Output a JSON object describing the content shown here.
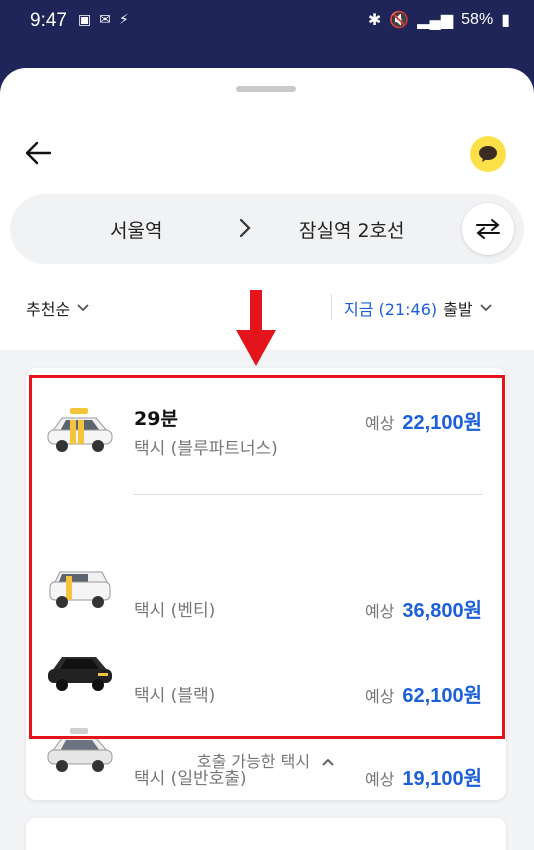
{
  "status_bar": {
    "time": "9:47",
    "battery": "58%"
  },
  "header": {
    "back_icon": "back-arrow-icon",
    "talk_icon": "chat-bubble-icon"
  },
  "route": {
    "origin": "서울역",
    "destination": "잠실역 2호선",
    "swap_icon": "swap-icon"
  },
  "filters": {
    "sort_label": "추천순",
    "time_prefix": "지금 (21:46)",
    "time_suffix": "출발"
  },
  "taxi_options": [
    {
      "duration": "29분",
      "name": "택시 (블루파트너스)",
      "price_label": "예상",
      "price": "22,100원",
      "car_color": "#f6c43c"
    },
    {
      "name": "택시 (벤티)",
      "price_label": "예상",
      "price": "36,800원",
      "car_color": "#f6c43c"
    },
    {
      "name": "택시 (블랙)",
      "price_label": "예상",
      "price": "62,100원",
      "car_color": "#222222"
    },
    {
      "name": "택시 (일반호출)",
      "price_label": "예상",
      "price": "19,100원",
      "car_color": "#c9c9c9"
    }
  ],
  "footer_toggle": "호출 가능한 택시",
  "colors": {
    "accent": "#1b5fd9",
    "highlight": "#e3141c"
  }
}
